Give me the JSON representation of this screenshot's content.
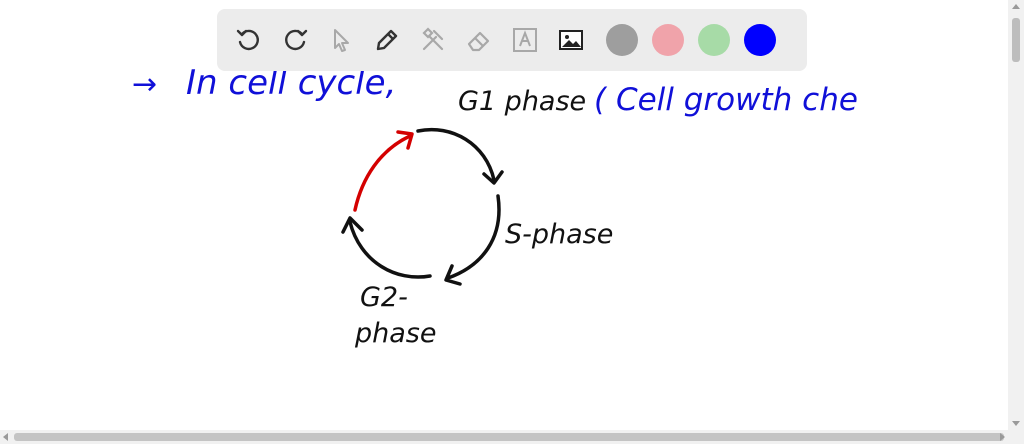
{
  "toolbar": {
    "tools": [
      "undo-icon",
      "redo-icon",
      "pointer-icon",
      "pen-icon",
      "tools-icon",
      "eraser-icon",
      "text-icon",
      "image-icon"
    ],
    "colors": [
      "#9e9e9e",
      "#f0a3aa",
      "#a7dba7",
      "#0000ff"
    ]
  },
  "handwriting": {
    "arrow": "→",
    "heading": "In cell cycle,",
    "g1_label": "G1 phase",
    "g1_note": "( Cell growth che",
    "s_label": "S-phase",
    "g2_label": "G2-",
    "g2_label_2": "phase"
  },
  "ink_colors": {
    "blue": "#1010d8",
    "black": "#111111",
    "red": "#d40000"
  }
}
